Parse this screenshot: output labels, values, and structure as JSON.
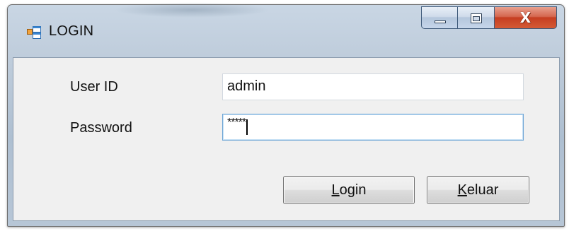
{
  "window": {
    "title": "LOGIN",
    "icon": "form-app-icon",
    "caption_buttons": {
      "minimize": "minimize-icon",
      "maximize": "maximize-icon",
      "close_glyph": "X"
    }
  },
  "form": {
    "userid_label": "User ID",
    "userid_value": "admin",
    "password_label": "Password",
    "password_value": "*****"
  },
  "buttons": {
    "login": {
      "mnemonic": "L",
      "rest": "ogin"
    },
    "keluar": {
      "mnemonic": "K",
      "rest": "eluar"
    }
  },
  "colors": {
    "close_button": "#c53e21",
    "focus_border": "#6fa6d6",
    "client_bg": "#f0f0f0"
  }
}
